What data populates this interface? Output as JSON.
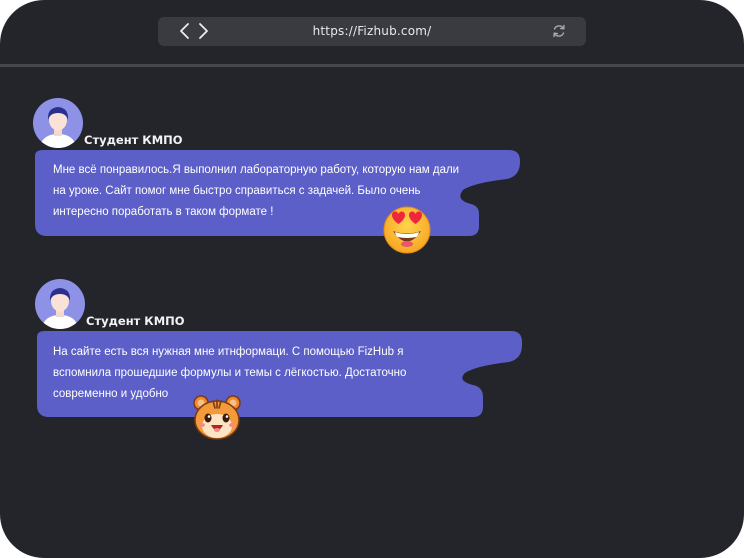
{
  "browser": {
    "url": "https://Fizhub.com/",
    "back_icon": "chevron-left-icon",
    "forward_icon": "chevron-right-icon",
    "reload_icon": "reload-icon"
  },
  "reviews": [
    {
      "author": "Студент КМПО",
      "text": "Мне всё понравилось.Я выполнил лабораторную работу, которую нам дали на уроке. Сайт помог мне быстро справиться с задачей. Было очень интересно поработать в таком формате !",
      "emoji": "heart-eyes-emoji"
    },
    {
      "author": "Студент КМПО",
      "text": "На сайте есть вся нужная мне итнформаци. С помощью FizHub я вспомнила прошедшие формулы и темы с лёгкостью. Достаточно современно и удобно",
      "emoji": "hamster-sticker"
    }
  ],
  "colors": {
    "background": "#23252b",
    "bubble": "#5b5fc7",
    "addressbar": "#3a3b40",
    "divider": "#46474c"
  }
}
